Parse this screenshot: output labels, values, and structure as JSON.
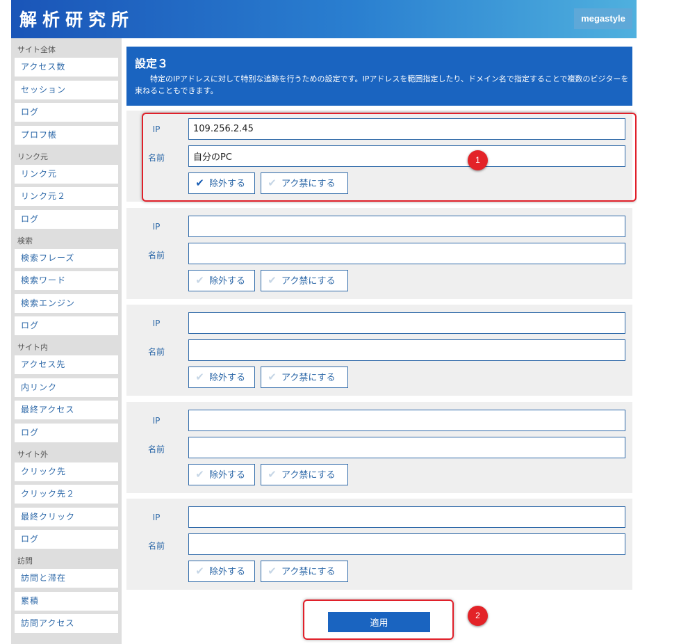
{
  "header": {
    "logo_text": "解析研究所",
    "brand": "megastyle"
  },
  "sidebar": {
    "sections": [
      {
        "title": "サイト全体",
        "items": [
          "アクセス数",
          "セッション",
          "ログ",
          "プロフ帳"
        ]
      },
      {
        "title": "リンク元",
        "items": [
          "リンク元",
          "リンク元２",
          "ログ"
        ]
      },
      {
        "title": "検索",
        "items": [
          "検索フレーズ",
          "検索ワード",
          "検索エンジン",
          "ログ"
        ]
      },
      {
        "title": "サイト内",
        "items": [
          "アクセス先",
          "内リンク",
          "最終アクセス",
          "ログ"
        ]
      },
      {
        "title": "サイト外",
        "items": [
          "クリック先",
          "クリック先２",
          "最終クリック",
          "ログ"
        ]
      },
      {
        "title": "訪問",
        "items": [
          "訪問と滞在",
          "累積",
          "訪問アクセス"
        ]
      }
    ]
  },
  "banner": {
    "title": "設定３",
    "description": "特定のIPアドレスに対して特別な追跡を行うための設定です。IPアドレスを範囲指定したり、ドメイン名で指定することで複数のビジターを束ねることもできます。"
  },
  "labels": {
    "ip": "IP",
    "name": "名前",
    "exclude": "除外する",
    "ban": "アク禁にする"
  },
  "entries": [
    {
      "ip": "109.256.2.45",
      "name": "自分のPC",
      "exclude": true,
      "ban": false
    },
    {
      "ip": "",
      "name": "",
      "exclude": false,
      "ban": false
    },
    {
      "ip": "",
      "name": "",
      "exclude": false,
      "ban": false
    },
    {
      "ip": "",
      "name": "",
      "exclude": false,
      "ban": false
    },
    {
      "ip": "",
      "name": "",
      "exclude": false,
      "ban": false
    }
  ],
  "apply_label": "適用",
  "annotations": [
    "1",
    "2"
  ],
  "icons": {
    "check": "checkmark-icon"
  },
  "colors": {
    "accent": "#1a64c0",
    "link": "#2d68a8",
    "highlight": "#e0202a"
  }
}
